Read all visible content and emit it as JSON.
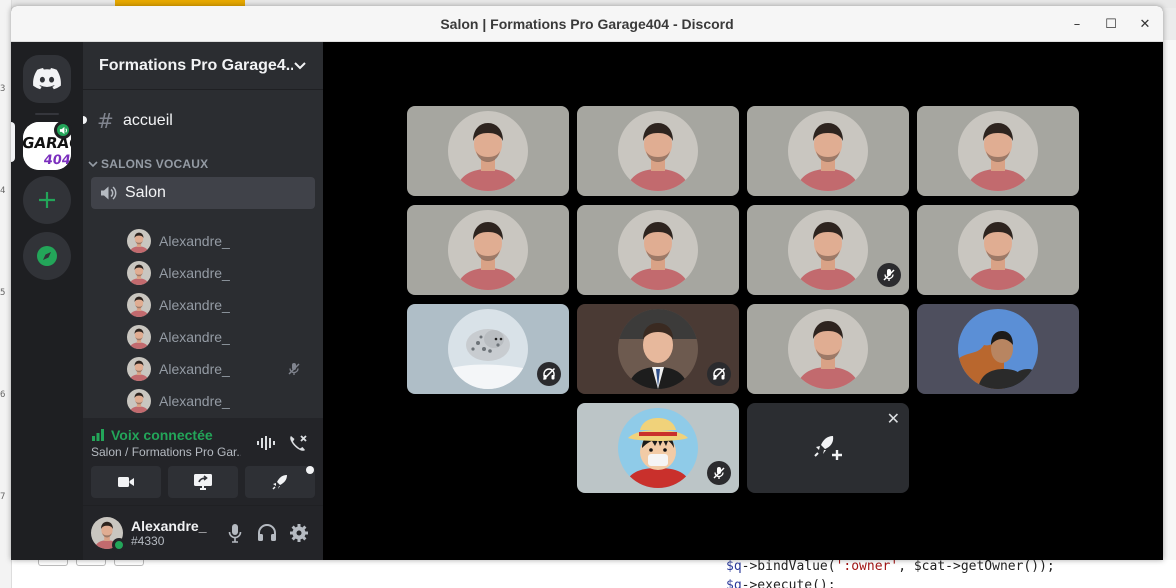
{
  "window": {
    "title": "Salon | Formations Pro Garage404 - Discord",
    "controls": {
      "minimize": "–",
      "maximize": "☐",
      "close": "✕"
    }
  },
  "background": {
    "line_numbers": [
      "3",
      "4",
      "5",
      "6",
      "7"
    ],
    "code_lines": [
      {
        "var": "$q",
        "rest": "->bindValue(",
        "str": "':owner'",
        "tail": ", $cat->getOwner());"
      },
      {
        "var": "$q",
        "rest": "->execute();",
        "str": "",
        "tail": ""
      }
    ]
  },
  "rail": {
    "home_icon": "discord-logo-icon",
    "guild_logo_text": "GARAGE 404",
    "add_icon": "plus-icon",
    "explore_icon": "compass-icon"
  },
  "sidebar": {
    "guild_name": "Formations Pro Garage4...",
    "text_channel": {
      "prefix": "#",
      "label": "accueil"
    },
    "category": "SALONS VOCAUX",
    "voice_channel": {
      "label": "Salon"
    },
    "members": [
      {
        "name": "Alexandre_",
        "avatar": "man",
        "muted": false
      },
      {
        "name": "Alexandre_",
        "avatar": "man",
        "muted": false
      },
      {
        "name": "Alexandre_",
        "avatar": "man",
        "muted": false
      },
      {
        "name": "Alexandre_",
        "avatar": "man",
        "muted": false
      },
      {
        "name": "Alexandre_",
        "avatar": "man",
        "muted": true
      },
      {
        "name": "Alexandre_",
        "avatar": "man",
        "muted": false
      },
      {
        "name": "Alexandre_",
        "avatar": "man",
        "muted": false
      }
    ]
  },
  "voice_panel": {
    "status": "Voix connectée",
    "subtitle": "Salon / Formations Pro Gar...",
    "status_color": "#23a559"
  },
  "user": {
    "name": "Alexandre_",
    "tag": "#4330",
    "status": "online"
  },
  "stage": {
    "tiles": [
      {
        "avatar": "man",
        "bg": "#a6a6a0",
        "muted": false
      },
      {
        "avatar": "man",
        "bg": "#a6a6a0",
        "muted": false
      },
      {
        "avatar": "man",
        "bg": "#a6a6a0",
        "muted": false
      },
      {
        "avatar": "man",
        "bg": "#a6a6a0",
        "muted": false
      },
      {
        "avatar": "man",
        "bg": "#a6a6a0",
        "muted": false
      },
      {
        "avatar": "man",
        "bg": "#a6a6a0",
        "muted": false
      },
      {
        "avatar": "man",
        "bg": "#a6a6a0",
        "muted": true
      },
      {
        "avatar": "man",
        "bg": "#a6a6a0",
        "muted": false
      },
      {
        "avatar": "leopard",
        "bg": "#afbec7",
        "muted": true
      },
      {
        "avatar": "office",
        "bg": "#4a3a34",
        "muted": true
      },
      {
        "avatar": "man",
        "bg": "#a6a6a0",
        "muted": false
      },
      {
        "avatar": "outdoor",
        "bg": "#4e4f5e",
        "muted": false
      },
      {
        "avatar": "anime",
        "bg": "#bcc5c7",
        "muted": true
      }
    ],
    "activity_icon": "rocket-plus-icon",
    "activity_close": "✕"
  },
  "colors": {
    "green": "#23a559",
    "rail": "#1e1f22",
    "sidebar": "#2b2d31",
    "panel": "#232428"
  }
}
